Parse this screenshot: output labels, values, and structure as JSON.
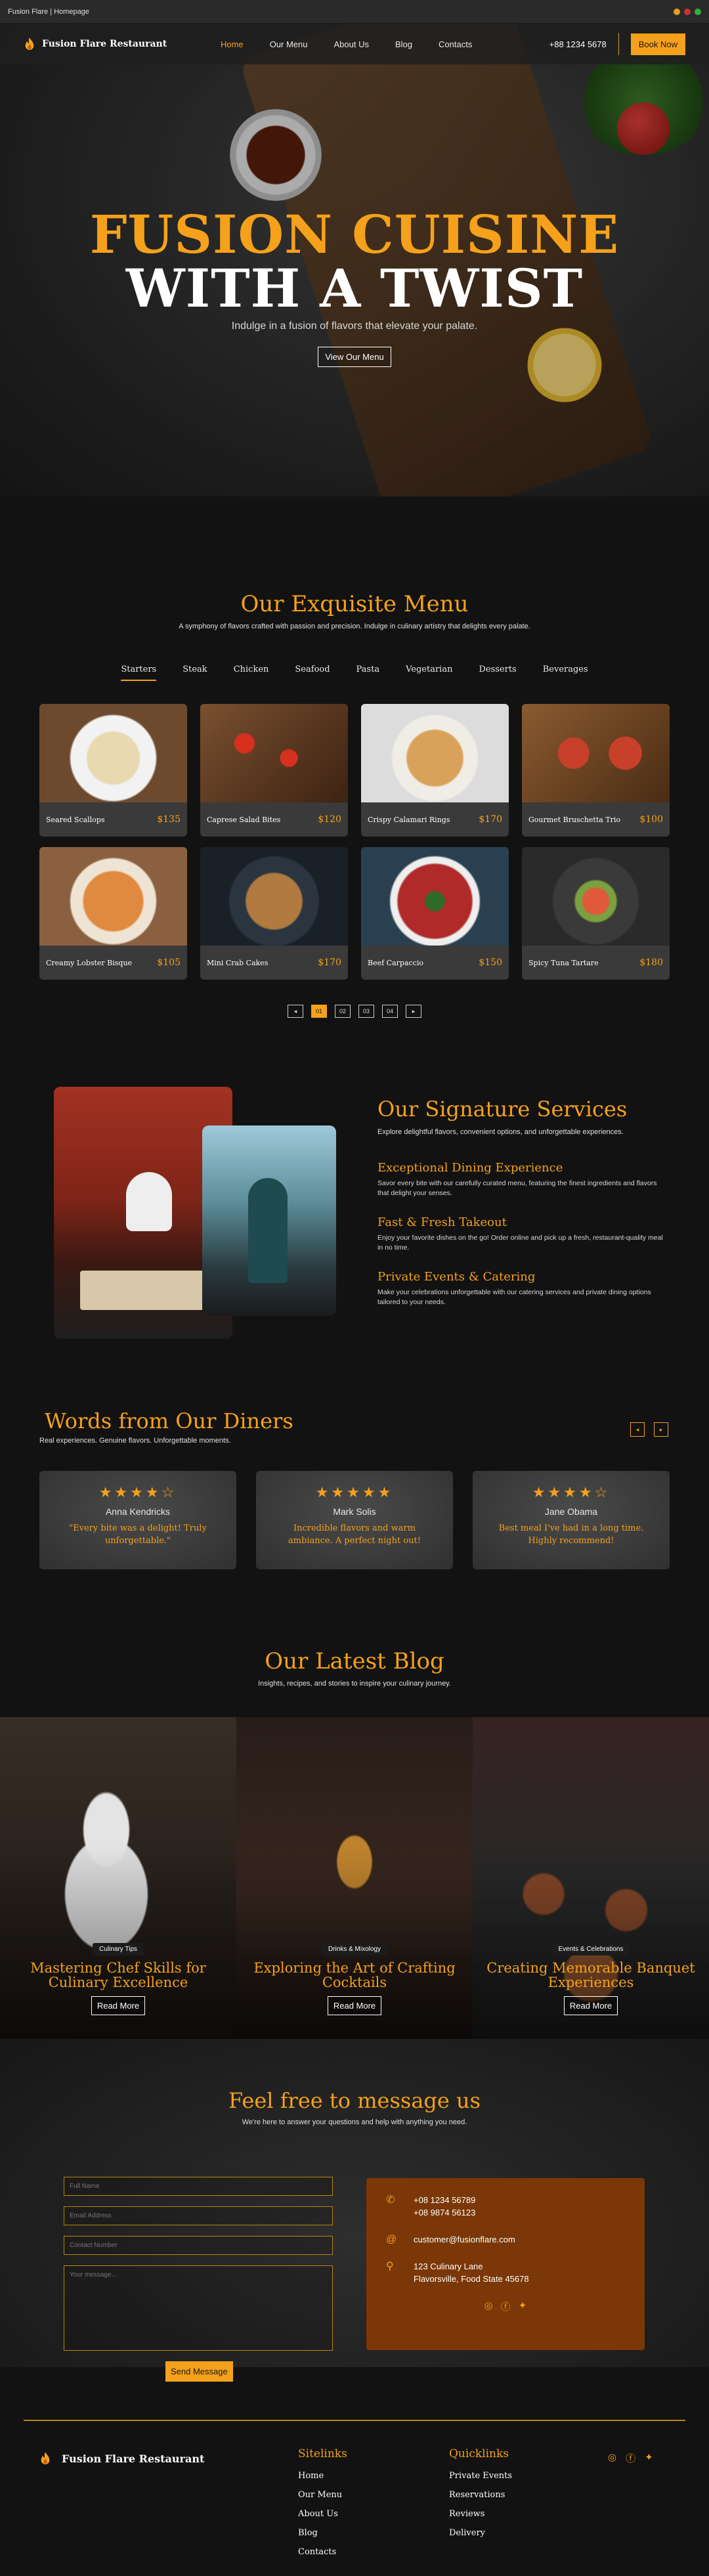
{
  "window": {
    "title": "Fusion Flare | Homepage",
    "dot_colors": [
      "#e0a020",
      "#d03030",
      "#30b040"
    ]
  },
  "nav": {
    "brand": "Fusion Flare Restaurant",
    "links": [
      "Home",
      "Our Menu",
      "About Us",
      "Blog",
      "Contacts"
    ],
    "active": "Home",
    "phone": "+88 1234 5678",
    "book_label": "Book Now"
  },
  "hero": {
    "line1": "FUSION CUISINE",
    "line2": "WITH A TWIST",
    "subtitle": "Indulge in a fusion of flavors that elevate your palate.",
    "cta": "View Our Menu"
  },
  "menu": {
    "title": "Our Exquisite Menu",
    "subtitle": "A symphony of flavors crafted with passion and precision. Indulge in culinary artistry that delights every palate.",
    "tabs": [
      "Starters",
      "Steak",
      "Chicken",
      "Seafood",
      "Pasta",
      "Vegetarian",
      "Desserts",
      "Beverages"
    ],
    "active_tab": "Starters",
    "items": [
      {
        "name": "Seared Scallops",
        "price": "$135"
      },
      {
        "name": "Caprese Salad Bites",
        "price": "$120"
      },
      {
        "name": "Crispy Calamari Rings",
        "price": "$170"
      },
      {
        "name": "Gourmet Bruschetta Trio",
        "price": "$100"
      },
      {
        "name": "Creamy Lobster Bisque",
        "price": "$105"
      },
      {
        "name": "Mini Crab Cakes",
        "price": "$170"
      },
      {
        "name": "Beef Carpaccio",
        "price": "$150"
      },
      {
        "name": "Spicy Tuna Tartare",
        "price": "$180"
      }
    ],
    "pagination": {
      "prev": "◂",
      "pages": [
        "01",
        "02",
        "03",
        "04"
      ],
      "current": "01",
      "next": "▸"
    }
  },
  "services": {
    "title": "Our Signature Services",
    "subtitle": "Explore delightful flavors, convenient options, and unforgettable experiences.",
    "items": [
      {
        "title": "Exceptional Dining Experience",
        "text": "Savor every bite with our carefully curated menu, featuring the finest ingredients and flavors that delight your senses."
      },
      {
        "title": "Fast & Fresh Takeout",
        "text": "Enjoy your favorite dishes on the go! Order online and pick up a fresh, restaurant-quality meal in no time."
      },
      {
        "title": "Private Events & Catering",
        "text": "Make your celebrations unforgettable with our catering services and private dining options tailored to your needs."
      }
    ]
  },
  "testimonials": {
    "title": "Words from Our Diners",
    "subtitle": "Real experiences. Genuine flavors. Unforgettable moments.",
    "prev": "◂",
    "next": "▸",
    "reviews": [
      {
        "stars": "★★★★☆",
        "rating": 4,
        "name": "Anna Kendricks",
        "quote": "\"Every bite was a delight! Truly unforgettable.\""
      },
      {
        "stars": "★★★★★",
        "rating": 5,
        "name": "Mark Solis",
        "quote": "Incredible flavors and warm ambiance. A perfect night out!"
      },
      {
        "stars": "★★★★☆",
        "rating": 4,
        "name": "Jane Obama",
        "quote": "Best meal I've had in a long time. Highly recommend!"
      }
    ]
  },
  "blog": {
    "title": "Our Latest Blog",
    "subtitle": "Insights, recipes, and stories to inspire your culinary journey.",
    "posts": [
      {
        "tag": "Culinary Tips",
        "title": "Mastering Chef Skills for Culinary Excellence",
        "cta": "Read More"
      },
      {
        "tag": "Drinks & Mixology",
        "title": "Exploring the Art of Crafting Cocktails",
        "cta": "Read More"
      },
      {
        "tag": "Events & Celebrations",
        "title": "Creating Memorable Banquet Experiences",
        "cta": "Read More"
      }
    ]
  },
  "contact": {
    "title": "Feel free to message us",
    "subtitle": "We're here to answer your questions and help with anything you need.",
    "placeholders": {
      "name": "Full Name",
      "email": "Email Address",
      "phone": "Contact Number",
      "message": "Your message..."
    },
    "send_label": "Send Message",
    "phone1": "+08 1234 56789",
    "phone2": "+08 9874 56123",
    "email": "customer@fusionflare.com",
    "address1": "123 Culinary Lane",
    "address2": "Flavorsville, Food State 45678"
  },
  "footer": {
    "brand": "Fusion Flare Restaurant",
    "sitelinks_title": "Sitelinks",
    "sitelinks": [
      "Home",
      "Our Menu",
      "About Us",
      "Blog",
      "Contacts"
    ],
    "quicklinks_title": "Quicklinks",
    "quicklinks": [
      "Private Events",
      "Reservations",
      "Reviews",
      "Delivery"
    ]
  },
  "colors": {
    "accent": "#f5a11b",
    "background": "#121212",
    "info_box": "#7b3707"
  }
}
